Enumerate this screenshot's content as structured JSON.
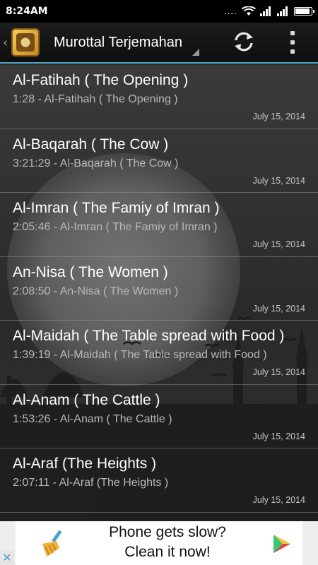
{
  "status_bar": {
    "time": "8:24AM",
    "dots": "...."
  },
  "action_bar": {
    "title": "Murottal Terjemahan",
    "icons": [
      "up-caret-icon",
      "app-logo",
      "refresh-icon",
      "overflow-menu-icon"
    ]
  },
  "list": {
    "items": [
      {
        "title": "Al-Fatihah ( The Opening )",
        "subtitle": "1:28 - Al-Fatihah ( The Opening )",
        "date": "July 15, 2014"
      },
      {
        "title": "Al-Baqarah ( The Cow )",
        "subtitle": "3:21:29 - Al-Baqarah ( The Cow )",
        "date": "July 15, 2014"
      },
      {
        "title": "Al-Imran ( The Famiy of Imran )",
        "subtitle": "2:05:46 - Al-Imran ( The Famiy of Imran )",
        "date": "July 15, 2014"
      },
      {
        "title": "An-Nisa ( The Women )",
        "subtitle": "2:08:50 - An-Nisa ( The Women )",
        "date": "July 15, 2014"
      },
      {
        "title": "Al-Maidah ( The Table spread with Food )",
        "subtitle": "1:39:19 - Al-Maidah ( The Table spread with Food )",
        "date": "July 15, 2014"
      },
      {
        "title": "Al-Anam ( The Cattle )",
        "subtitle": "1:53:26 - Al-Anam ( The Cattle )",
        "date": "July 15, 2014"
      },
      {
        "title": "Al-Araf (The Heights )",
        "subtitle": "2:07:11 - Al-Araf (The Heights )",
        "date": "July 15, 2014"
      }
    ]
  },
  "ad": {
    "headline": "Phone gets slow?",
    "subline": "Clean it now!",
    "close": "✕",
    "colors": {
      "broom": "#4aa0cf",
      "play": "#2fb6e8"
    }
  }
}
